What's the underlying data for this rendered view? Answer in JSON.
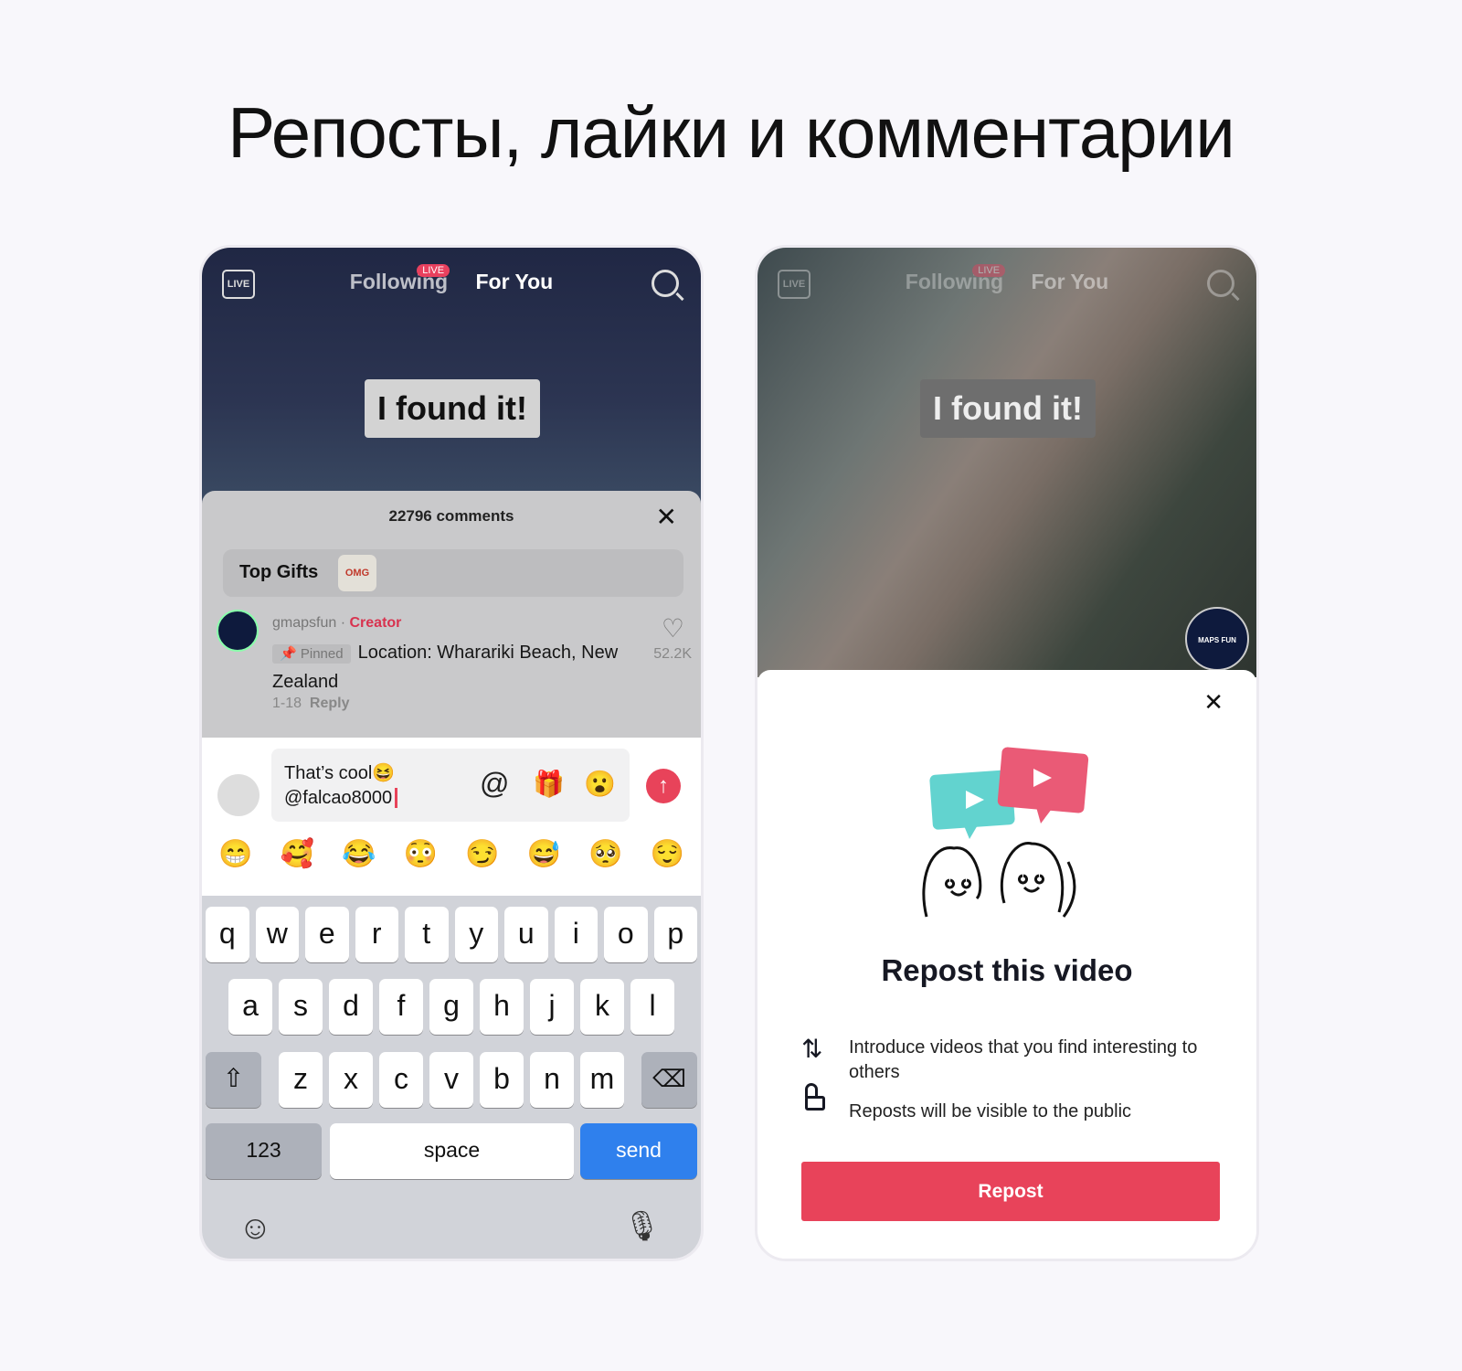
{
  "title": "Репосты, лайки и комментарии",
  "header": {
    "live": "LIVE",
    "following": "Following",
    "live_badge": "LIVE",
    "for_you": "For You"
  },
  "video_caption": "I found it!",
  "comments": {
    "count": "22796 comments",
    "top_gifts": "Top Gifts",
    "gift_label": "OMG",
    "items": [
      {
        "user": "gmapsfun",
        "separator": "·",
        "role": "Creator",
        "pinned": "Pinned",
        "text": "Location: Wharariki Beach, New Zealand",
        "date": "1-18",
        "reply": "Reply",
        "likes": "52.2K"
      }
    ]
  },
  "composer": {
    "line1": "That’s cool😆",
    "line2": "@falcao8000"
  },
  "emojis": [
    "😁",
    "🥰",
    "😂",
    "😳",
    "😏",
    "😅",
    "🥺",
    "😌"
  ],
  "keyboard": {
    "row1": [
      "q",
      "w",
      "e",
      "r",
      "t",
      "y",
      "u",
      "i",
      "o",
      "p"
    ],
    "row2": [
      "a",
      "s",
      "d",
      "f",
      "g",
      "h",
      "j",
      "k",
      "l"
    ],
    "row3": [
      "z",
      "x",
      "c",
      "v",
      "b",
      "n",
      "m"
    ],
    "numbers": "123",
    "space": "space",
    "send": "send"
  },
  "repost": {
    "heading": "Repost this video",
    "points": [
      "Introduce videos that you find interesting to others",
      "Reposts will be visible to the public"
    ],
    "button": "Repost",
    "avatar_text": "MAPS FUN"
  },
  "colors": {
    "accent": "#e8435a",
    "send_key": "#2f80ed"
  }
}
